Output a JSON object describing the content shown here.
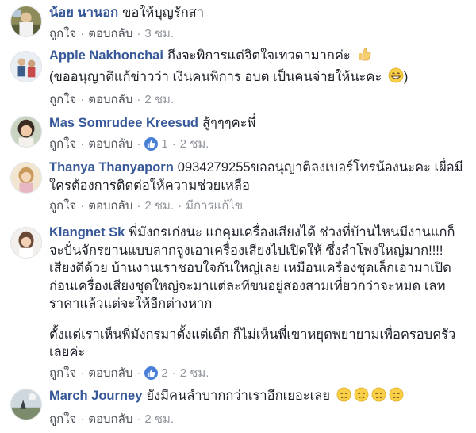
{
  "actions": {
    "like": "ถูกใจ",
    "reply": "ตอบกลับ",
    "sep": "·"
  },
  "comments": [
    {
      "name": "น้อย นานอก",
      "text": "ขอให้บุญรักสา",
      "time": "3 ชม."
    },
    {
      "name": "Apple Nakhonchai",
      "text": "ถึงจะพิการแต่จิตใจเทวดามากค่ะ",
      "text2": "(ขออนุญาติแก้ข่าวว่า เงินคนพิการ อบต เป็นคนจ่ายให้นะคะ",
      "text2_end": ")",
      "time": "2 ชม.",
      "emoji": [
        "thumbs-up-emoji",
        "grin-emoji"
      ]
    },
    {
      "name": "Mas Somrudee Kreesud",
      "text": "สู้ๆๆๆคะพี่",
      "likes": "1",
      "time": "2 ชม."
    },
    {
      "name": "Thanya Thanyaporn",
      "text": "0934279255ขออนุญาติลงเบอร์โทรน้องนะคะ เผื่อมีใครต้องการติดต่อให้ความช่วยเหลือ",
      "time": "2 ชม.",
      "edited": "มีการแก้ไข"
    },
    {
      "name": "Klangnet Sk",
      "text": "พี่มังกรเก่งนะ แกคุมเครื่องเสียงได้ ช่วงที่บ้านไหนมีงานแกก็จะปั่นจักรยานแบบลากจูงเอาเครื่องเสียงไปเปิดให้ ซึ่งลำโพงใหญ่มาก!!!! เสียงดีด้วย บ้านงานเราชอบใจกันใหญ่เลย เหมือนเครื่องชุดเล็กเอามาเปิดก่อนเครื่องเสียงชุดใหญ่จะมาแต่ละทีขนอยู่สองสามเที่ยวกว่าจะหมด เลทราคาแล้วแต่จะให้อีกต่างหาก",
      "text2": "ตั้งแต่เราเห็นพี่มังกรมาตั้งแต่เด็ก ก็ไม่เห็นพี่เขาหยุดพยายามเพื่อครอบครัวเลยค่ะ",
      "likes": "2",
      "time": "2 ชม."
    },
    {
      "name": "March Journey",
      "text": "ยังมีคนลำบากกว่าเราอีกเยอะเลย",
      "time": "2 ชม.",
      "emoji": [
        "sad-emoji",
        "sad-emoji",
        "sad-emoji",
        "sad-emoji"
      ]
    }
  ],
  "colors": {
    "name": "#365899",
    "text": "#1d2129",
    "meta": "#90949c",
    "like_badge": "#4a7fd8"
  }
}
